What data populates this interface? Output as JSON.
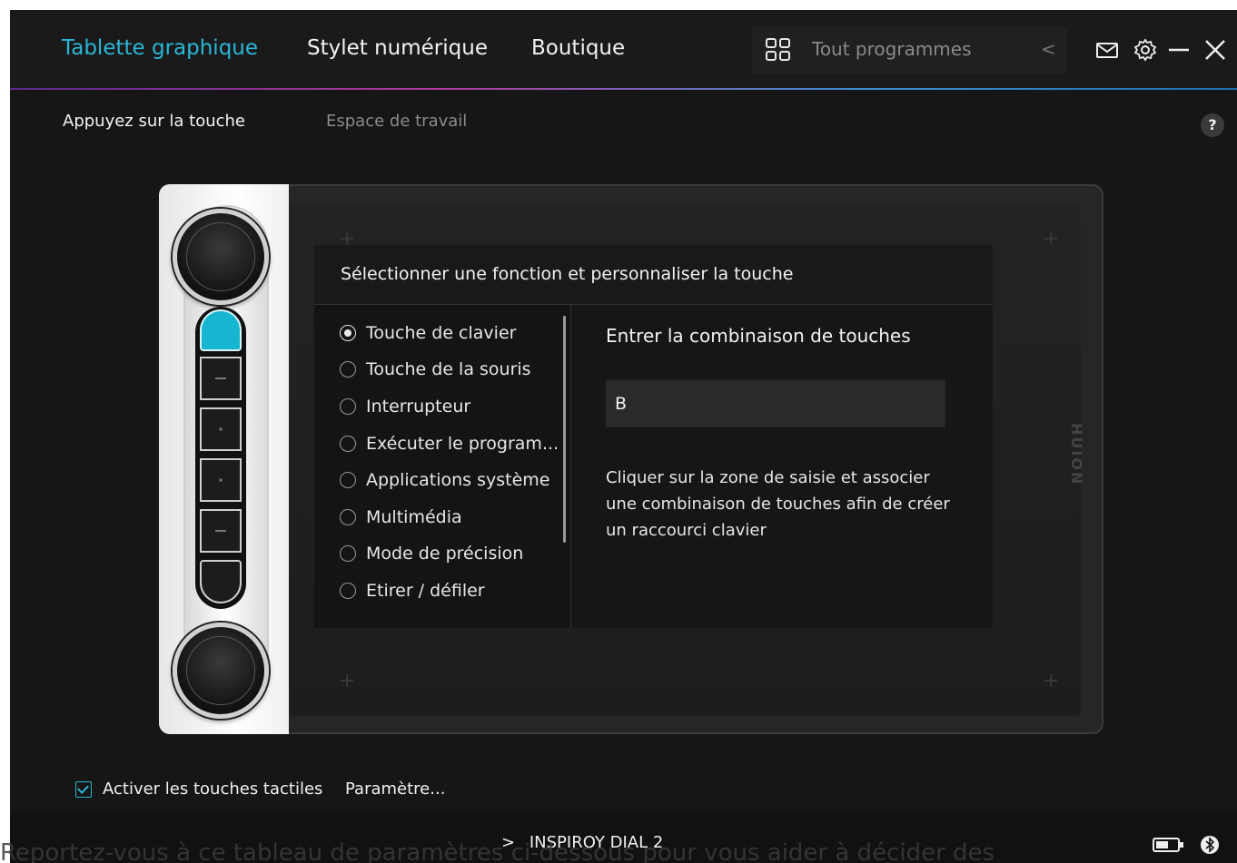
{
  "topbar": {
    "nav": [
      "Tablette graphique",
      "Stylet numérique",
      "Boutique"
    ],
    "active_nav": "Tablette graphique",
    "program_selector": "Tout programmes",
    "arrow": "<"
  },
  "subtabs": [
    "Appuyez sur la touche",
    "Espace de travail"
  ],
  "help": "?",
  "dialog": {
    "title": "Sélectionner une fonction et personnaliser la touche",
    "functions": [
      "Touche de clavier",
      "Touche de la souris",
      "Interrupteur",
      "Exécuter le program...",
      "Applications système",
      "Multimédia",
      "Mode de précision",
      "Etirer / défiler"
    ],
    "selected_function": "Touche de clavier",
    "combo_title": "Entrer la combinaison de touches",
    "combo_value": "B",
    "combo_help": "Cliquer sur la zone de saisie et associer une combinaison de touches afin de créer un raccourci clavier"
  },
  "tablet": {
    "brand": "HUION"
  },
  "options": {
    "enable_label": "Activer les touches tactiles",
    "enable_checked": true,
    "settings_label": "Paramètre..."
  },
  "footer": {
    "device": "INSPIROY DIAL 2",
    "device_arrow": ">"
  },
  "caption": "Reportez-vous à ce tableau de paramètres ci-dessous pour vous aider à décider des",
  "colors": {
    "accent": "#2bb7d6",
    "background": "#161616",
    "key_highlight": "#17b5cf"
  }
}
